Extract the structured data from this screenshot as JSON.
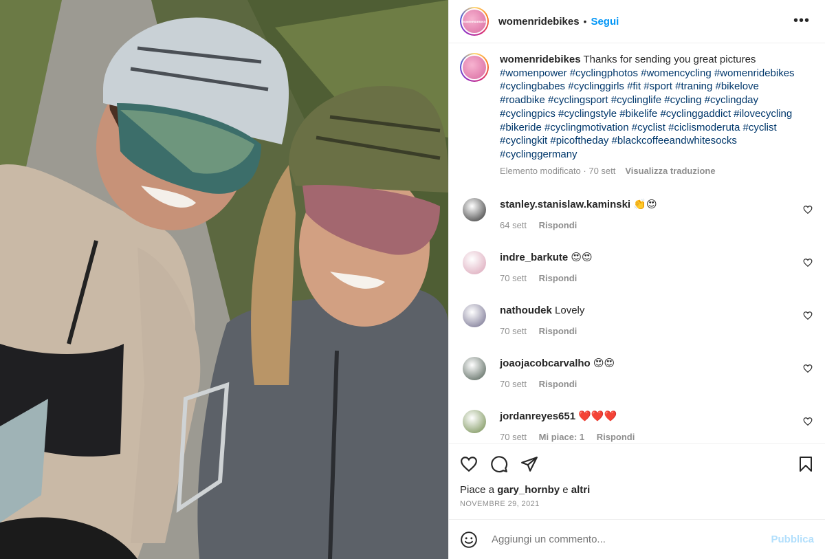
{
  "post": {
    "author": "womenridebikes",
    "follow_label": "Segui",
    "more_label": "•••",
    "avatar_text": "WOMENRIDEBIKES"
  },
  "caption": {
    "author": "womenridebikes",
    "text": "Thanks for sending you great pictures",
    "hashtags": "#womenpower #cyclingphotos #womencycling #womenridebikes #cyclingbabes #cyclinggirls #fit #sport #traning #bikelove #roadbike #cyclingsport #cyclinglife #cycling #cyclingday #cyclingpics #cyclingstyle #bikelife #cyclinggaddict #ilovecycling #bikeride #cyclingmotivation #cyclist #ciclismoderuta #cyclist #cyclingkit #picoftheday #blackcoffeeandwhitesocks #cyclinggermany",
    "meta": "Elemento modificato · 70 sett",
    "translate_label": "Visualizza traduzione"
  },
  "comments": [
    {
      "user": "stanley.stanislaw.kaminski",
      "text": "👏😍",
      "time": "64 sett",
      "likes": "",
      "reply": "Rispondi",
      "color": "#2c2c2c"
    },
    {
      "user": "indre_barkute",
      "text": "😍😍",
      "time": "70 sett",
      "likes": "",
      "reply": "Rispondi",
      "color": "#d9a1b5"
    },
    {
      "user": "nathoudek",
      "text": "Lovely",
      "time": "70 sett",
      "likes": "",
      "reply": "Rispondi",
      "color": "#6e6a8a"
    },
    {
      "user": "joaojacobcarvalho",
      "text": "😍😍",
      "time": "70 sett",
      "likes": "",
      "reply": "Rispondi",
      "color": "#4a5a4f"
    },
    {
      "user": "jordanreyes651",
      "text": "❤️❤️❤️",
      "time": "70 sett",
      "likes": "Mi piace: 1",
      "reply": "Rispondi",
      "color": "#6f8a4b"
    }
  ],
  "likes": {
    "prefix": "Piace a",
    "user": "gary_hornby",
    "conj": "e",
    "others": "altri"
  },
  "date": "NOVEMBRE 29, 2021",
  "add_comment": {
    "placeholder": "Aggiungi un commento...",
    "publish_label": "Pubblica"
  },
  "colors": {
    "accent": "#0095f6",
    "hashtag": "#00376b",
    "muted": "#8e8e8e",
    "publish_disabled": "#b2dffc"
  },
  "icons": [
    "more-icon",
    "heart-icon",
    "comment-icon",
    "share-icon",
    "bookmark-icon",
    "emoji-icon"
  ]
}
